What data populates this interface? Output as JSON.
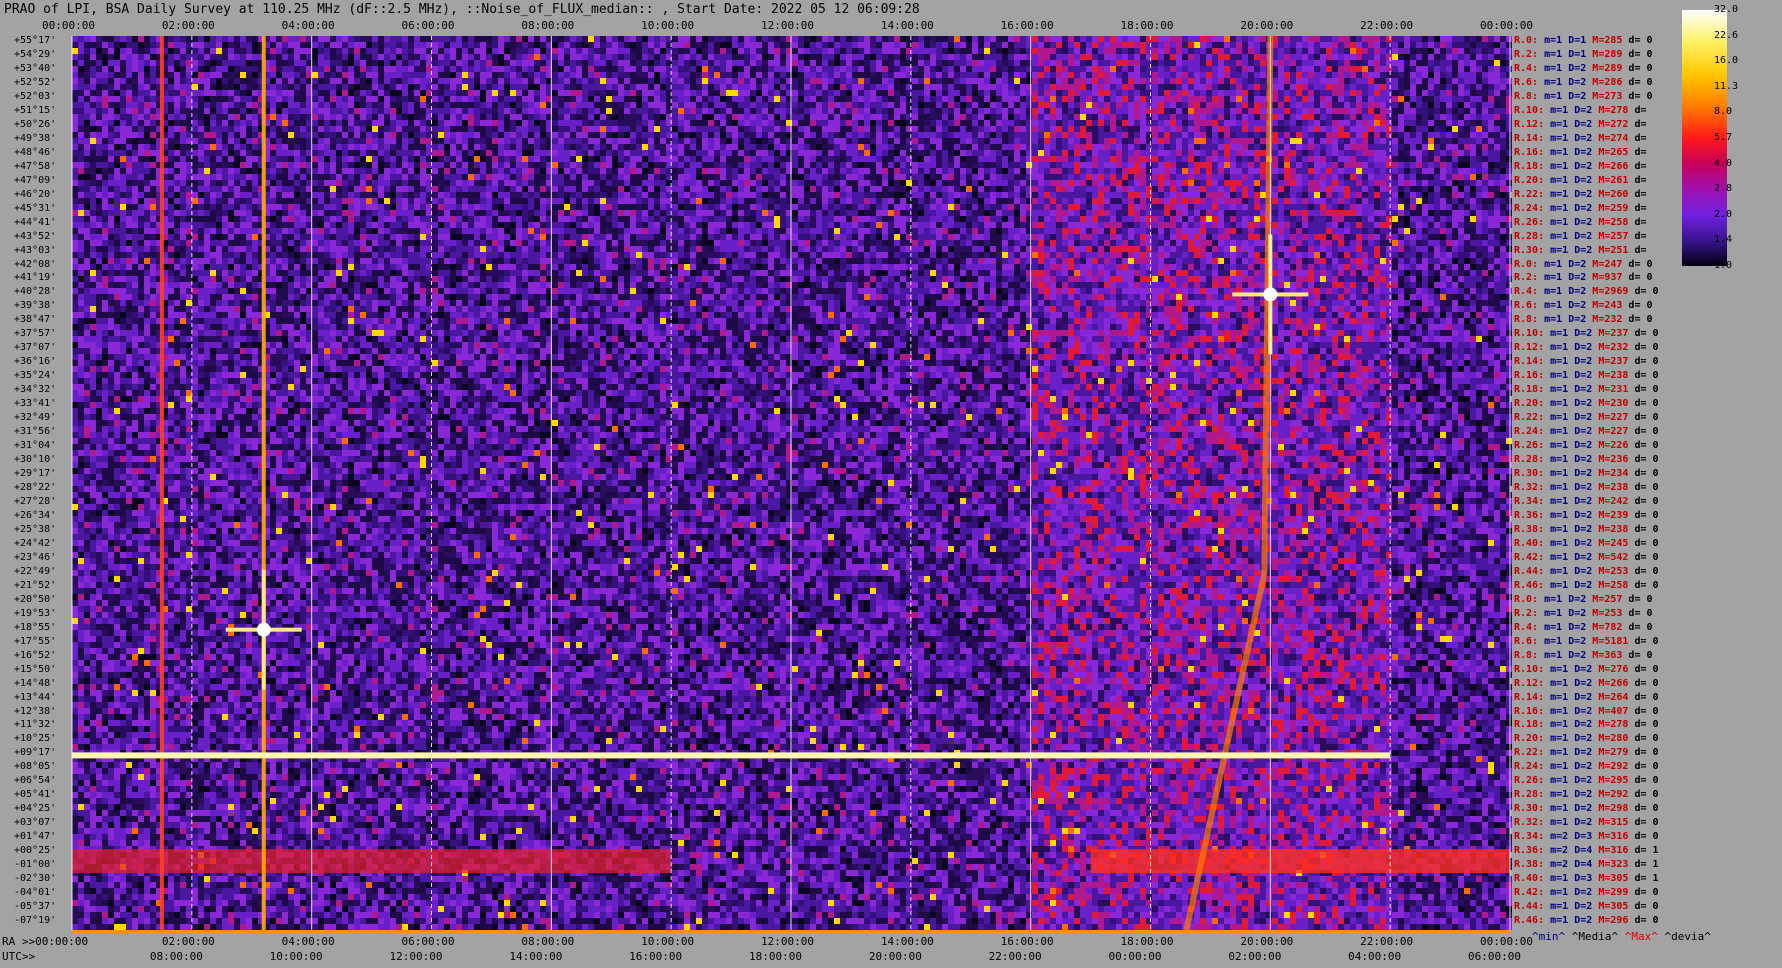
{
  "title": "PRAO of LPI, BSA Daily Survey at 110.25 MHz (dF::2.5 MHz), ::Noise_of_FLUX_median:: , Start Date: 2022 05 12 06:09:28",
  "chart_data": {
    "type": "heatmap",
    "x_top_ticks": [
      "00:00:00",
      "02:00:00",
      "04:00:00",
      "06:00:00",
      "08:00:00",
      "10:00:00",
      "12:00:00",
      "14:00:00",
      "16:00:00",
      "18:00:00",
      "20:00:00",
      "22:00:00",
      "00:00:00"
    ],
    "x_bottom_ra_label": "RA >>00:00:00",
    "x_bottom_utc_label": "UTC>>",
    "x_bottom_utc_ticks": [
      "08:00:00",
      "10:00:00",
      "12:00:00",
      "14:00:00",
      "16:00:00",
      "18:00:00",
      "20:00:00",
      "22:00:00",
      "00:00:00",
      "02:00:00",
      "04:00:00",
      "06:00:00"
    ],
    "y_declinations": [
      "+55°17'",
      "+54°29'",
      "+53°40'",
      "+52°52'",
      "+52°03'",
      "+51°15'",
      "+50°26'",
      "+49°38'",
      "+48°46'",
      "+47°58'",
      "+47°09'",
      "+46°20'",
      "+45°31'",
      "+44°41'",
      "+43°52'",
      "+43°03'",
      "+42°08'",
      "+41°19'",
      "+40°28'",
      "+39°38'",
      "+38°47'",
      "+37°57'",
      "+37°07'",
      "+36°16'",
      "+35°24'",
      "+34°32'",
      "+33°41'",
      "+32°49'",
      "+31°56'",
      "+31°04'",
      "+30°10'",
      "+29°17'",
      "+28°22'",
      "+27°28'",
      "+26°34'",
      "+25°38'",
      "+24°42'",
      "+23°46'",
      "+22°49'",
      "+21°52'",
      "+20°50'",
      "+19°53'",
      "+18°55'",
      "+17°55'",
      "+16°52'",
      "+15°50'",
      "+14°48'",
      "+13°44'",
      "+12°38'",
      "+11°32'",
      "+10°25'",
      "+09°17'",
      "+08°05'",
      "+06°54'",
      "+05°41'",
      "+04°25'",
      "+03°07'",
      "+01°47'",
      "+00°25'",
      "-01°00'",
      "-02°30'",
      "-04°01'",
      "-05°37'",
      "-07°19'"
    ],
    "colorbar": {
      "ticks": [
        "32.0",
        "22.6",
        "16.0",
        "11.3",
        "8.0",
        "5.7",
        "4.0",
        "2.8",
        "2.0",
        "1.4",
        "1.0"
      ],
      "colors": [
        "#ffffff",
        "#fff080",
        "#ffd800",
        "#ff9000",
        "#ff3000",
        "#d00020",
        "#b01080",
        "#8020d0",
        "#5020a0",
        "#201050",
        "#000010"
      ]
    },
    "ra_range_hours": [
      0,
      24
    ],
    "features": [
      {
        "name": "vertical source",
        "ra_hours": 3.2
      },
      {
        "name": "vertical source",
        "ra_hours": 1.5
      },
      {
        "name": "bright source",
        "ra_hours": 20.0,
        "dec": "+40°28'"
      },
      {
        "name": "bright source",
        "ra_hours": 3.2,
        "dec": "+18°55'"
      },
      {
        "name": "horizontal band",
        "dec": "+09°17'",
        "ra_end_hours": 22.0
      },
      {
        "name": "equatorial band",
        "dec": "-01°00'"
      }
    ]
  },
  "stats": [
    {
      "r": "R.0:",
      "m": "m=1",
      "d": "D=1",
      "x": "M=285",
      "z": "d= 0"
    },
    {
      "r": "R.2:",
      "m": "m=1",
      "d": "D=1",
      "x": "M=289",
      "z": "d= 0"
    },
    {
      "r": "R.4:",
      "m": "m=1",
      "d": "D=2",
      "x": "M=289",
      "z": "d= 0"
    },
    {
      "r": "R.6:",
      "m": "m=1",
      "d": "D=2",
      "x": "M=286",
      "z": "d= 0"
    },
    {
      "r": "R.8:",
      "m": "m=1",
      "d": "D=2",
      "x": "M=273",
      "z": "d= 0"
    },
    {
      "r": "R.10:",
      "m": "m=1",
      "d": "D=2",
      "x": "M=278",
      "z": "d="
    },
    {
      "r": "R.12:",
      "m": "m=1",
      "d": "D=2",
      "x": "M=272",
      "z": "d="
    },
    {
      "r": "R.14:",
      "m": "m=1",
      "d": "D=2",
      "x": "M=274",
      "z": "d="
    },
    {
      "r": "R.16:",
      "m": "m=1",
      "d": "D=2",
      "x": "M=265",
      "z": "d="
    },
    {
      "r": "R.18:",
      "m": "m=1",
      "d": "D=2",
      "x": "M=266",
      "z": "d="
    },
    {
      "r": "R.20:",
      "m": "m=1",
      "d": "D=2",
      "x": "M=261",
      "z": "d="
    },
    {
      "r": "R.22:",
      "m": "m=1",
      "d": "D=2",
      "x": "M=260",
      "z": "d="
    },
    {
      "r": "R.24:",
      "m": "m=1",
      "d": "D=2",
      "x": "M=259",
      "z": "d="
    },
    {
      "r": "R.26:",
      "m": "m=1",
      "d": "D=2",
      "x": "M=258",
      "z": "d="
    },
    {
      "r": "R.28:",
      "m": "m=1",
      "d": "D=2",
      "x": "M=257",
      "z": "d="
    },
    {
      "r": "R.30:",
      "m": "m=1",
      "d": "D=2",
      "x": "M=251",
      "z": "d="
    },
    {
      "r": "R.0:",
      "m": "m=1",
      "d": "D=2",
      "x": "M=247",
      "z": "d= 0"
    },
    {
      "r": "R.2:",
      "m": "m=1",
      "d": "D=2",
      "x": "M=937",
      "z": "d= 0"
    },
    {
      "r": "R.4:",
      "m": "m=1",
      "d": "D=2",
      "x": "M=2969",
      "z": "d= 0"
    },
    {
      "r": "R.6:",
      "m": "m=1",
      "d": "D=2",
      "x": "M=243",
      "z": "d= 0"
    },
    {
      "r": "R.8:",
      "m": "m=1",
      "d": "D=2",
      "x": "M=232",
      "z": "d= 0"
    },
    {
      "r": "R.10:",
      "m": "m=1",
      "d": "D=2",
      "x": "M=237",
      "z": "d= 0"
    },
    {
      "r": "R.12:",
      "m": "m=1",
      "d": "D=2",
      "x": "M=232",
      "z": "d= 0"
    },
    {
      "r": "R.14:",
      "m": "m=1",
      "d": "D=2",
      "x": "M=237",
      "z": "d= 0"
    },
    {
      "r": "R.16:",
      "m": "m=1",
      "d": "D=2",
      "x": "M=238",
      "z": "d= 0"
    },
    {
      "r": "R.18:",
      "m": "m=1",
      "d": "D=2",
      "x": "M=231",
      "z": "d= 0"
    },
    {
      "r": "R.20:",
      "m": "m=1",
      "d": "D=2",
      "x": "M=230",
      "z": "d= 0"
    },
    {
      "r": "R.22:",
      "m": "m=1",
      "d": "D=2",
      "x": "M=227",
      "z": "d= 0"
    },
    {
      "r": "R.24:",
      "m": "m=1",
      "d": "D=2",
      "x": "M=227",
      "z": "d= 0"
    },
    {
      "r": "R.26:",
      "m": "m=1",
      "d": "D=2",
      "x": "M=226",
      "z": "d= 0"
    },
    {
      "r": "R.28:",
      "m": "m=1",
      "d": "D=2",
      "x": "M=236",
      "z": "d= 0"
    },
    {
      "r": "R.30:",
      "m": "m=1",
      "d": "D=2",
      "x": "M=234",
      "z": "d= 0"
    },
    {
      "r": "R.32:",
      "m": "m=1",
      "d": "D=2",
      "x": "M=238",
      "z": "d= 0"
    },
    {
      "r": "R.34:",
      "m": "m=1",
      "d": "D=2",
      "x": "M=242",
      "z": "d= 0"
    },
    {
      "r": "R.36:",
      "m": "m=1",
      "d": "D=2",
      "x": "M=239",
      "z": "d= 0"
    },
    {
      "r": "R.38:",
      "m": "m=1",
      "d": "D=2",
      "x": "M=238",
      "z": "d= 0"
    },
    {
      "r": "R.40:",
      "m": "m=1",
      "d": "D=2",
      "x": "M=245",
      "z": "d= 0"
    },
    {
      "r": "R.42:",
      "m": "m=1",
      "d": "D=2",
      "x": "M=542",
      "z": "d= 0"
    },
    {
      "r": "R.44:",
      "m": "m=1",
      "d": "D=2",
      "x": "M=253",
      "z": "d= 0"
    },
    {
      "r": "R.46:",
      "m": "m=1",
      "d": "D=2",
      "x": "M=258",
      "z": "d= 0"
    },
    {
      "r": "R.0:",
      "m": "m=1",
      "d": "D=2",
      "x": "M=257",
      "z": "d= 0"
    },
    {
      "r": "R.2:",
      "m": "m=1",
      "d": "D=2",
      "x": "M=253",
      "z": "d= 0"
    },
    {
      "r": "R.4:",
      "m": "m=1",
      "d": "D=2",
      "x": "M=782",
      "z": "d= 0"
    },
    {
      "r": "R.6:",
      "m": "m=1",
      "d": "D=2",
      "x": "M=5181",
      "z": "d= 0"
    },
    {
      "r": "R.8:",
      "m": "m=1",
      "d": "D=2",
      "x": "M=363",
      "z": "d= 0"
    },
    {
      "r": "R.10:",
      "m": "m=1",
      "d": "D=2",
      "x": "M=276",
      "z": "d= 0"
    },
    {
      "r": "R.12:",
      "m": "m=1",
      "d": "D=2",
      "x": "M=266",
      "z": "d= 0"
    },
    {
      "r": "R.14:",
      "m": "m=1",
      "d": "D=2",
      "x": "M=264",
      "z": "d= 0"
    },
    {
      "r": "R.16:",
      "m": "m=1",
      "d": "D=2",
      "x": "M=407",
      "z": "d= 0"
    },
    {
      "r": "R.18:",
      "m": "m=1",
      "d": "D=2",
      "x": "M=278",
      "z": "d= 0"
    },
    {
      "r": "R.20:",
      "m": "m=1",
      "d": "D=2",
      "x": "M=280",
      "z": "d= 0"
    },
    {
      "r": "R.22:",
      "m": "m=1",
      "d": "D=2",
      "x": "M=279",
      "z": "d= 0"
    },
    {
      "r": "R.24:",
      "m": "m=1",
      "d": "D=2",
      "x": "M=292",
      "z": "d= 0"
    },
    {
      "r": "R.26:",
      "m": "m=1",
      "d": "D=2",
      "x": "M=295",
      "z": "d= 0"
    },
    {
      "r": "R.28:",
      "m": "m=1",
      "d": "D=2",
      "x": "M=292",
      "z": "d= 0"
    },
    {
      "r": "R.30:",
      "m": "m=1",
      "d": "D=2",
      "x": "M=298",
      "z": "d= 0"
    },
    {
      "r": "R.32:",
      "m": "m=1",
      "d": "D=2",
      "x": "M=315",
      "z": "d= 0"
    },
    {
      "r": "R.34:",
      "m": "m=2",
      "d": "D=3",
      "x": "M=316",
      "z": "d= 0"
    },
    {
      "r": "R.36:",
      "m": "m=2",
      "d": "D=4",
      "x": "M=316",
      "z": "d= 1"
    },
    {
      "r": "R.38:",
      "m": "m=2",
      "d": "D=4",
      "x": "M=323",
      "z": "d= 1"
    },
    {
      "r": "R.40:",
      "m": "m=1",
      "d": "D=3",
      "x": "M=305",
      "z": "d= 1"
    },
    {
      "r": "R.42:",
      "m": "m=1",
      "d": "D=2",
      "x": "M=299",
      "z": "d= 0"
    },
    {
      "r": "R.44:",
      "m": "m=1",
      "d": "D=2",
      "x": "M=305",
      "z": "d= 0"
    },
    {
      "r": "R.46:",
      "m": "m=1",
      "d": "D=2",
      "x": "M=296",
      "z": "d= 0"
    }
  ],
  "legend_footer": {
    "min": "^min^",
    "median": "^Media^",
    "max": "^Max^",
    "dev": "^devia^"
  }
}
